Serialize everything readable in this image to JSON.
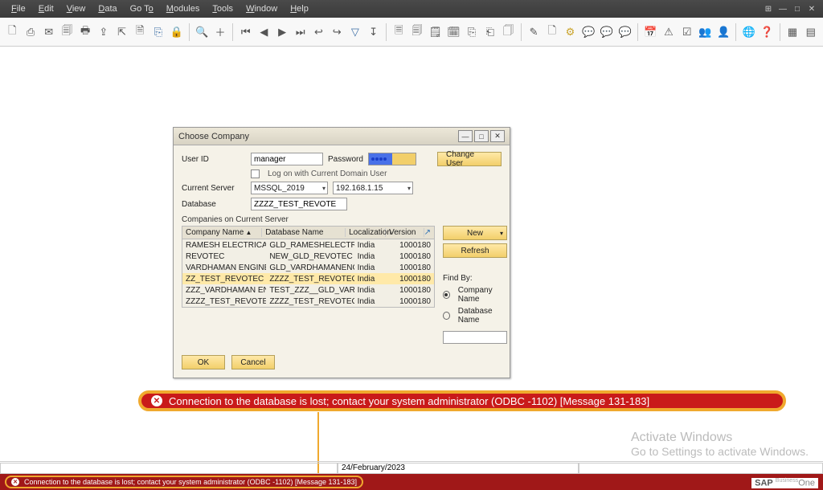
{
  "menubar": {
    "items": [
      "File",
      "Edit",
      "View",
      "Data",
      "Go To",
      "Modules",
      "Tools",
      "Window",
      "Help"
    ]
  },
  "dialog": {
    "title": "Choose Company",
    "user_id_label": "User ID",
    "user_id_value": "manager",
    "password_label": "Password",
    "change_user_label": "Change User",
    "logon_domain_label": "Log on with Current Domain User",
    "current_server_label": "Current Server",
    "current_server_value": "MSSQL_2019",
    "server_ip_value": "192.168.1.15",
    "database_label": "Database",
    "database_value": "ZZZZ_TEST_REVOTE",
    "companies_label": "Companies on Current Server",
    "grid_headers": {
      "company": "Company Name",
      "db": "Database Name",
      "loc": "Localization",
      "ver": "Version"
    },
    "grid_rows": [
      {
        "company": "RAMESH ELECTRICAL",
        "db": "GLD_RAMESHELECTRIC",
        "loc": "India",
        "ver": "1000180"
      },
      {
        "company": "REVOTEC",
        "db": "NEW_GLD_REVOTEC",
        "loc": "India",
        "ver": "1000180"
      },
      {
        "company": "VARDHAMAN ENGINE",
        "db": "GLD_VARDHAMANENG",
        "loc": "India",
        "ver": "1000180"
      },
      {
        "company": "ZZ_TEST_REVOTEC",
        "db": "ZZZZ_TEST_REVOTEC_",
        "loc": "India",
        "ver": "1000180"
      },
      {
        "company": "ZZZ_VARDHAMAN EN",
        "db": "TEST_ZZZ__GLD_VARD",
        "loc": "India",
        "ver": "1000180"
      },
      {
        "company": "ZZZZ_TEST_REVOTEC",
        "db": "ZZZZ_TEST_REVOTEC_",
        "loc": "India",
        "ver": "1000180"
      }
    ],
    "selected_row_index": 3,
    "new_label": "New",
    "refresh_label": "Refresh",
    "find_by_label": "Find By:",
    "find_by_option1": "Company Name",
    "find_by_option2": "Database Name",
    "ok_label": "OK",
    "cancel_label": "Cancel"
  },
  "error": {
    "text": "Connection to the database is lost; contact your system administrator (ODBC -1102)  [Message 131-183]"
  },
  "status": {
    "date": "24/February/2023",
    "error_text": "Connection to the database is lost; contact your system administrator (ODBC -1102)  [Message 131-183]"
  },
  "watermark": {
    "title": "Activate Windows",
    "subtitle": "Go to Settings to activate Windows."
  },
  "branding": {
    "sap": "SAP",
    "suffix": "Business",
    "one": "One"
  }
}
